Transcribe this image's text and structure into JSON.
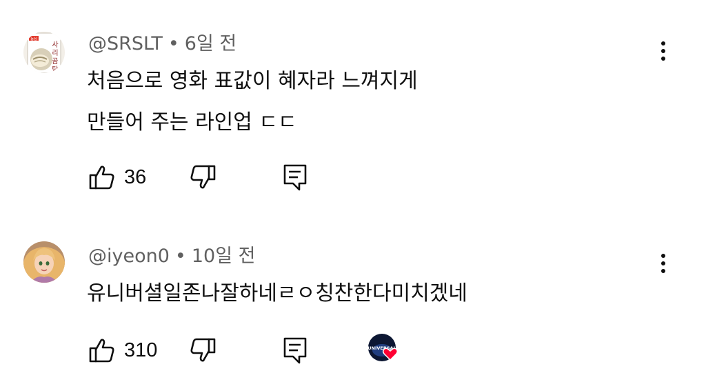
{
  "comments": [
    {
      "author": "@SRSLT",
      "separator": "•",
      "time": "6일 전",
      "lines": [
        "처음으로 영화 표값이 혜자라 느껴지게",
        "만들어 주는 라인업 ㄷㄷ"
      ],
      "likes": "36",
      "avatar_icon": "noodle-package-avatar",
      "avatar_text": "사리곰탕",
      "avatar_brand": "농심"
    },
    {
      "author": "@iyeon0",
      "separator": "•",
      "time": "10일 전",
      "lines": [
        "유니버셜일존나잘하네ㄹㅇ칭찬한다미치겠네"
      ],
      "likes": "310",
      "avatar_icon": "princess-character-avatar",
      "creator_heart_label": "UNIVERSAL"
    }
  ],
  "icons": {
    "like": "thumbs-up-icon",
    "dislike": "thumbs-down-icon",
    "reply": "reply-icon",
    "more": "more-vert-icon",
    "heart": "creator-heart-icon"
  },
  "colors": {
    "meta": "#606060",
    "text": "#0f0f0f",
    "heart": "#ff0033"
  }
}
